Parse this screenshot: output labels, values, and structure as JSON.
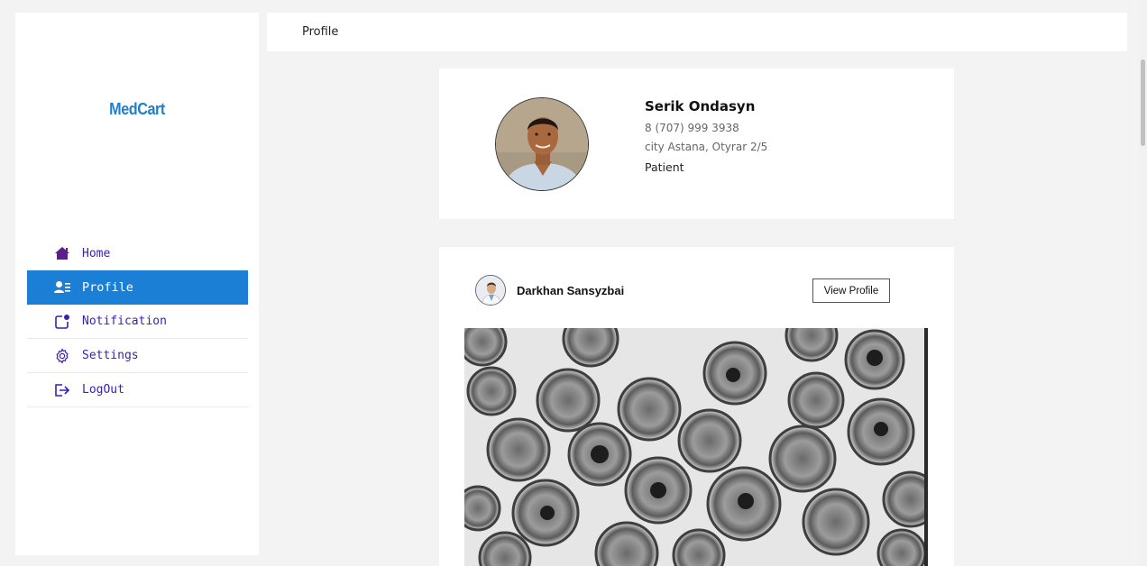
{
  "app": {
    "brand": "MedCart"
  },
  "colors": {
    "accent": "#1c7fd6",
    "brand": "#1e7fd0",
    "nav_text": "#3a1fb0",
    "home_icon": "#5a1f8a"
  },
  "sidebar": {
    "items": [
      {
        "id": "home",
        "label": "Home",
        "icon": "home-icon",
        "active": false
      },
      {
        "id": "profile",
        "label": "Profile",
        "icon": "user-list-icon",
        "active": true
      },
      {
        "id": "notification",
        "label": "Notification",
        "icon": "notification-icon",
        "active": false
      },
      {
        "id": "settings",
        "label": "Settings",
        "icon": "gear-icon",
        "active": false
      },
      {
        "id": "logout",
        "label": "LogOut",
        "icon": "logout-icon",
        "active": false
      }
    ]
  },
  "header": {
    "title": "Profile"
  },
  "profile": {
    "name": "Serik Ondasyn",
    "phone": "8 (707) 999 3938",
    "address": "city Astana, Otyrar 2/5",
    "role": "Patient"
  },
  "post": {
    "author": "Darkhan Sansyzbai",
    "view_profile_label": "View Profile"
  }
}
